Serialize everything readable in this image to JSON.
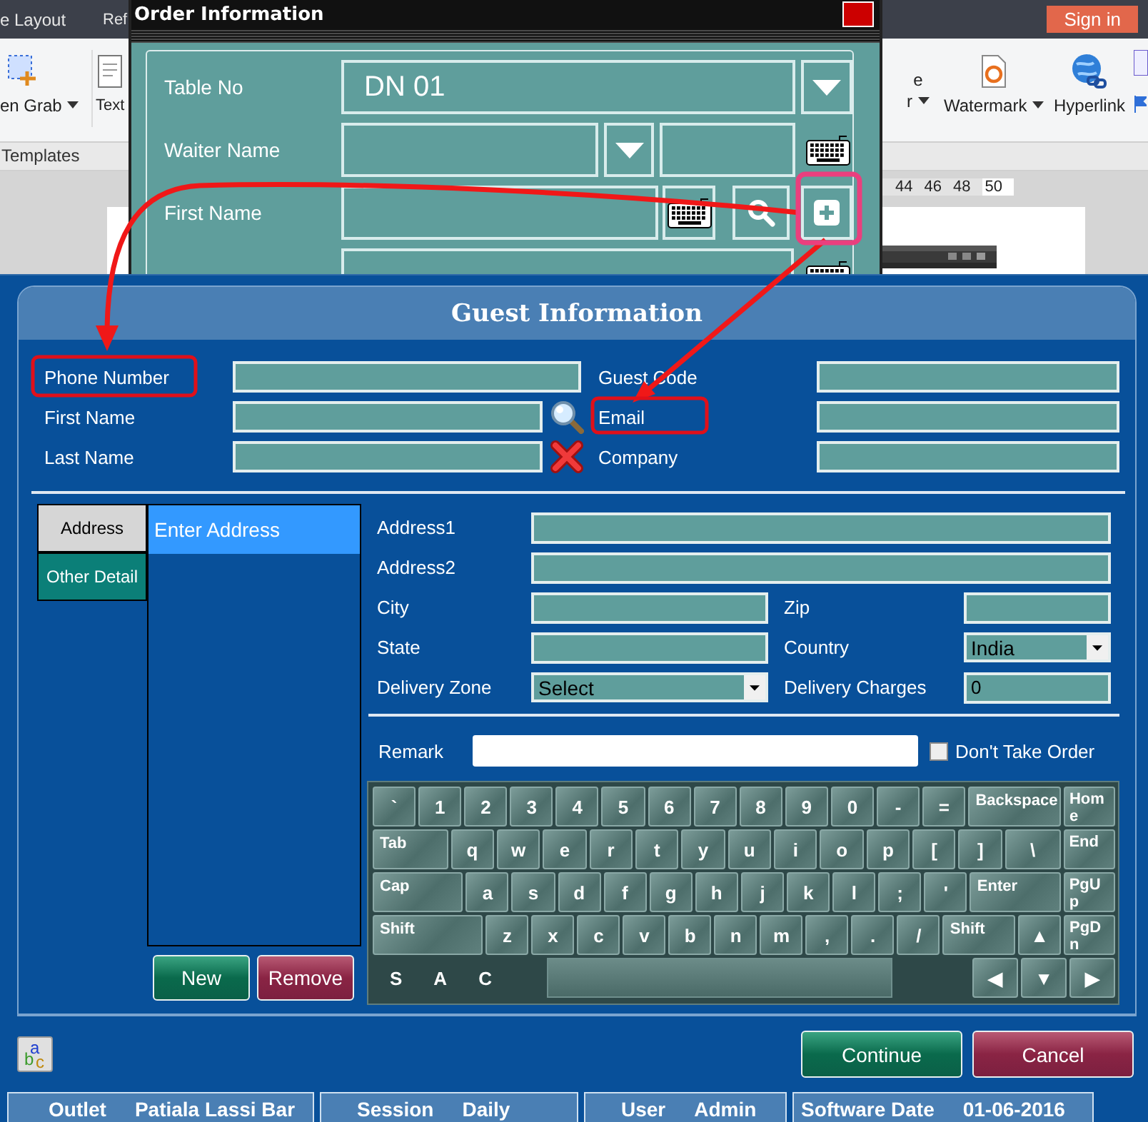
{
  "background_app": {
    "menu_tabs": [
      "e Layout",
      "Ref"
    ],
    "sign_in": "Sign in",
    "ribbon_left": [
      {
        "kind": "grab",
        "lines": [
          "en Grab"
        ],
        "dropdown": true
      },
      {
        "kind": "text",
        "lines": [
          "Text"
        ]
      }
    ],
    "ribbon_right": [
      {
        "kind": "blank",
        "lines": [
          "e",
          "r"
        ],
        "dropdown": true
      },
      {
        "kind": "watermark",
        "lines": [
          "Watermark"
        ],
        "dropdown": true
      },
      {
        "kind": "hyperlink",
        "lines": [
          "Hyperlink"
        ],
        "dropdown": false
      }
    ],
    "section_label": "Templates",
    "ruler_ticks": [
      "44",
      "46",
      "48",
      "50"
    ]
  },
  "order_window": {
    "title": "Order Information",
    "rows": [
      {
        "kind": "table",
        "label": "Table No",
        "value": "DN 01"
      },
      {
        "kind": "waiter",
        "label": "Waiter Name"
      },
      {
        "kind": "name",
        "label": "First Name"
      }
    ]
  },
  "guest_window": {
    "title": "Guest Information",
    "left_fields": [
      {
        "label": "Phone Number",
        "kind": "plain"
      },
      {
        "label": "First Name",
        "kind": "search"
      },
      {
        "label": "Last Name",
        "kind": "clear"
      }
    ],
    "right_fields": [
      {
        "label": "Guest Code"
      },
      {
        "label": "Email"
      },
      {
        "label": "Company"
      }
    ],
    "tabs": [
      {
        "label": "Address",
        "selected": true
      },
      {
        "label": "Other Detail",
        "selected": false
      }
    ],
    "address_list": [
      {
        "label": "Enter Address",
        "selected": true
      }
    ],
    "list_buttons": [
      {
        "label": "New",
        "kind": "confirm"
      },
      {
        "label": "Remove",
        "kind": "danger"
      }
    ],
    "address_form": [
      [
        {
          "label": "Address1",
          "kind": "text"
        }
      ],
      [
        {
          "label": "Address2",
          "kind": "text"
        }
      ],
      [
        {
          "label": "City",
          "kind": "text"
        },
        {
          "label": "Zip",
          "kind": "text"
        }
      ],
      [
        {
          "label": "State",
          "kind": "text"
        },
        {
          "label": "Country",
          "kind": "select",
          "value": "India"
        }
      ],
      [
        {
          "label": "Delivery Zone",
          "kind": "select",
          "value": "Select"
        },
        {
          "label": "Delivery Charges",
          "kind": "text",
          "value": "0"
        }
      ]
    ],
    "remark": {
      "label": "Remark"
    },
    "dont_take_order": {
      "label": "Don't Take Order",
      "checked": false
    },
    "keyboard": {
      "rows": [
        [
          "`",
          "1",
          "2",
          "3",
          "4",
          "5",
          "6",
          "7",
          "8",
          "9",
          "0",
          "-",
          "=",
          "Backspace",
          "Home"
        ],
        [
          "Tab",
          "q",
          "w",
          "e",
          "r",
          "t",
          "y",
          "u",
          "i",
          "o",
          "p",
          "[",
          "]",
          "\\",
          "End"
        ],
        [
          "Cap",
          "a",
          "s",
          "d",
          "f",
          "g",
          "h",
          "j",
          "k",
          "l",
          ";",
          "'",
          "Enter",
          "PgUp"
        ],
        [
          "Shift",
          "z",
          "x",
          "c",
          "v",
          "b",
          "n",
          "m",
          ",",
          ".",
          "/",
          "Shift",
          "▲",
          "PgDn"
        ]
      ],
      "modifiers": [
        "S",
        "A",
        "C"
      ],
      "arrows": [
        "◀",
        "▼",
        "▶"
      ]
    },
    "spelling_button": {
      "letters": [
        "a",
        "b",
        "c"
      ]
    },
    "dialog_buttons": [
      {
        "label": "Continue",
        "kind": "confirm"
      },
      {
        "label": "Cancel",
        "kind": "danger"
      }
    ]
  },
  "status_bar": [
    {
      "label": "Outlet",
      "value": "Patiala Lassi Bar"
    },
    {
      "label": "Session",
      "value": "Daily"
    },
    {
      "label": "User",
      "value": "Admin"
    },
    {
      "label": "Software Date",
      "value": "01-06-2016"
    }
  ]
}
